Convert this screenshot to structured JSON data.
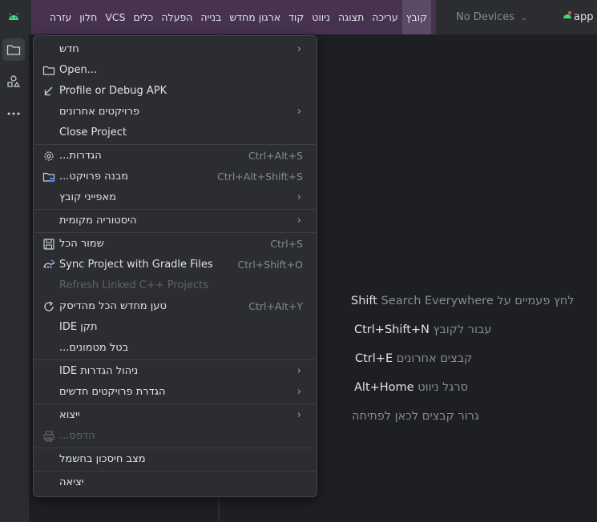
{
  "menubar": {
    "items": [
      "קובץ",
      "עריכה",
      "תצוגה",
      "ניווט",
      "קוד",
      "ארגון מחדש",
      "בנייה",
      "הפעלה",
      "כלים",
      "VCS",
      "חלון",
      "עזרה"
    ],
    "active_index": 0
  },
  "toolbar": {
    "devices_label": "No Devices",
    "run_config_label": "app"
  },
  "file_menu": {
    "new": "חדש",
    "open": "Open...",
    "profile_apk": "Profile or Debug APK",
    "recent_projects": "פרויקטים אחרונים",
    "close_project": "Close Project",
    "settings": "הגדרות...",
    "settings_shortcut": "Ctrl+Alt+S",
    "project_structure": "מבנה פרויקט...",
    "project_structure_shortcut": "Ctrl+Alt+Shift+S",
    "file_properties": "מאפייני קובץ",
    "local_history": "היסטוריה מקומית",
    "save_all": "שמור הכל",
    "save_all_shortcut": "Ctrl+S",
    "sync_gradle": "Sync Project with Gradle Files",
    "sync_gradle_shortcut": "Ctrl+Shift+O",
    "refresh_cpp": "Refresh Linked C++ Projects",
    "reload_disk": "טען מחדש הכל מהדיסק",
    "reload_disk_shortcut": "Ctrl+Alt+Y",
    "repair_ide": "תקן IDE",
    "invalidate_caches": "בטל מטמונים...",
    "manage_ide_settings": "ניהול הגדרות IDE",
    "new_projects_setup": "הגדרת פרויקטים חדשים",
    "export": "ייצוא",
    "print": "הדפס...",
    "power_save": "מצב חיסכון בחשמל",
    "exit": "יציאה"
  },
  "welcome_hints": {
    "search_everywhere": "לחץ פעמיים על",
    "search_everywhere_key": "Shift",
    "search_everywhere_action": "Search Everywhere",
    "goto_file": "עבור לקובץ",
    "goto_file_key": "Ctrl+Shift+N",
    "recent_files": "קבצים אחרונים",
    "recent_files_key": "Ctrl+E",
    "nav_bar": "סרגל ניווט",
    "nav_bar_key": "Alt+Home",
    "drop_files": "גרור קבצים לכאן לפתיחה"
  },
  "colors": {
    "accent_menubar": "#47334f",
    "android_green": "#3ddc84",
    "background": "#1e1f22"
  }
}
